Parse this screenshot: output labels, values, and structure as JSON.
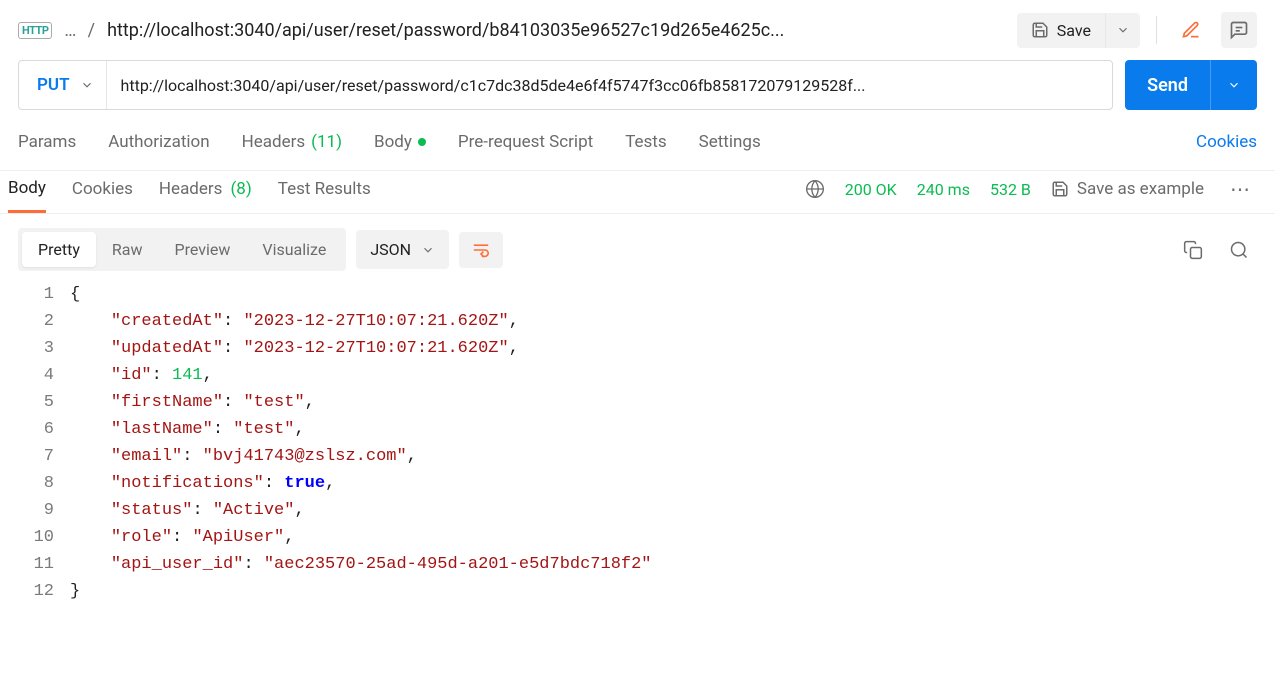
{
  "breadcrumb": {
    "collapsed": "...",
    "title": "http://localhost:3040/api/user/reset/password/b84103035e96527c19d265e4625c..."
  },
  "header_actions": {
    "save_label": "Save"
  },
  "request": {
    "method": "PUT",
    "url": "http://localhost:3040/api/user/reset/password/c1c7dc38d5de4e6f4f5747f3cc06fb858172079129528f...",
    "send_label": "Send"
  },
  "req_tabs": {
    "params": "Params",
    "authorization": "Authorization",
    "headers": "Headers",
    "headers_count": "(11)",
    "body": "Body",
    "prerequest": "Pre-request Script",
    "tests": "Tests",
    "settings": "Settings",
    "cookies": "Cookies"
  },
  "resp_tabs": {
    "body": "Body",
    "cookies": "Cookies",
    "headers": "Headers",
    "headers_count": "(8)",
    "test_results": "Test Results"
  },
  "resp_meta": {
    "status": "200 OK",
    "time": "240 ms",
    "size": "532 B",
    "save_example": "Save as example"
  },
  "view": {
    "pretty": "Pretty",
    "raw": "Raw",
    "preview": "Preview",
    "visualize": "Visualize",
    "format": "JSON"
  },
  "json_body": {
    "lines": [
      1,
      2,
      3,
      4,
      5,
      6,
      7,
      8,
      9,
      10,
      11,
      12
    ],
    "l1": "{",
    "l2_k": "\"createdAt\"",
    "l2_v": "\"2023-12-27T10:07:21.620Z\"",
    "l3_k": "\"updatedAt\"",
    "l3_v": "\"2023-12-27T10:07:21.620Z\"",
    "l4_k": "\"id\"",
    "l4_v": "141",
    "l5_k": "\"firstName\"",
    "l5_v": "\"test\"",
    "l6_k": "\"lastName\"",
    "l6_v": "\"test\"",
    "l7_k": "\"email\"",
    "l7_v": "\"bvj41743@zslsz.com\"",
    "l8_k": "\"notifications\"",
    "l8_v": "true",
    "l9_k": "\"status\"",
    "l9_v": "\"Active\"",
    "l10_k": "\"role\"",
    "l10_v": "\"ApiUser\"",
    "l11_k": "\"api_user_id\"",
    "l11_v": "\"aec23570-25ad-495d-a201-e5d7bdc718f2\"",
    "l12": "}"
  }
}
